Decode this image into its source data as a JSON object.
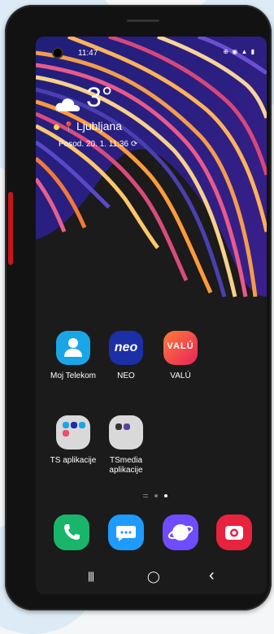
{
  "status_bar": {
    "time": "11:47",
    "icons": "⊕ ◉ ▲ ▮"
  },
  "weather": {
    "temperature": "3°",
    "location": "Ljubljana",
    "updated": "Posod. 20. 1. 11:36"
  },
  "apps": [
    {
      "label": "Moj Telekom",
      "color": "#1aa6e6"
    },
    {
      "label": "NEO",
      "color": "#1b2fa6",
      "icon_text": "neo"
    },
    {
      "label": "VALÚ",
      "color": "#ef4b6b",
      "icon_text": "VALÚ"
    }
  ],
  "folders": [
    {
      "label": "TS aplikacije"
    },
    {
      "label": "TSmedia aplikacije"
    }
  ],
  "dock": [
    {
      "name": "phone",
      "color": "#19b56a"
    },
    {
      "name": "messages",
      "color": "#1e9bff"
    },
    {
      "name": "internet",
      "color": "#6f4cff"
    },
    {
      "name": "camera",
      "color": "#e8233e"
    }
  ],
  "nav": {
    "recents": "|||",
    "home": "◯",
    "back": "‹"
  }
}
